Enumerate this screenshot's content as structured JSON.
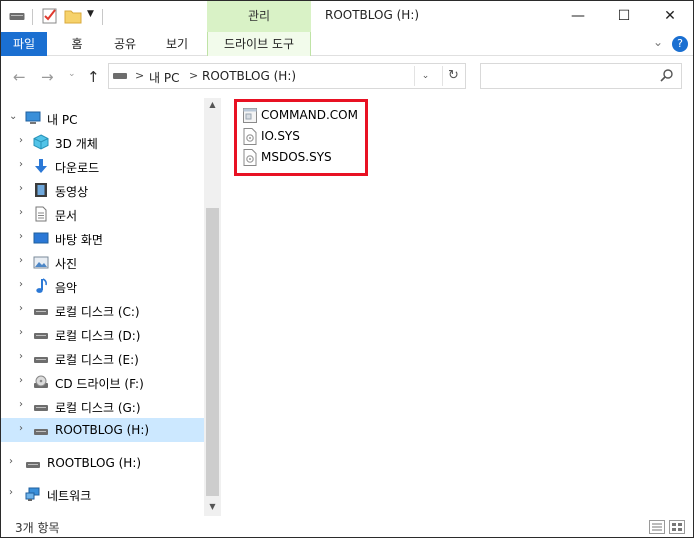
{
  "window": {
    "title": "ROOTBLOG (H:)",
    "context_tab_header": "관리",
    "controls": {
      "minimize": "—",
      "maximize": "☐",
      "close": "✕"
    }
  },
  "ribbon": {
    "tabs": [
      {
        "label": "파일"
      },
      {
        "label": "홈"
      },
      {
        "label": "공유"
      },
      {
        "label": "보기"
      },
      {
        "label": "드라이브 도구"
      }
    ],
    "help": "?"
  },
  "address": {
    "crumbs": [
      "내 PC",
      "ROOTBLOG (H:)"
    ],
    "separator": ">",
    "search_placeholder": ""
  },
  "nav_tree": [
    {
      "label": "내 PC",
      "icon": "pc-icon",
      "expanded": true
    },
    {
      "label": "3D 개체",
      "icon": "3d-objects-icon"
    },
    {
      "label": "다운로드",
      "icon": "download-icon"
    },
    {
      "label": "동영상",
      "icon": "video-icon"
    },
    {
      "label": "문서",
      "icon": "document-icon"
    },
    {
      "label": "바탕 화면",
      "icon": "desktop-icon"
    },
    {
      "label": "사진",
      "icon": "pictures-icon"
    },
    {
      "label": "음악",
      "icon": "music-icon"
    },
    {
      "label": "로컬 디스크 (C:)",
      "icon": "drive-icon"
    },
    {
      "label": "로컬 디스크 (D:)",
      "icon": "drive-icon"
    },
    {
      "label": "로컬 디스크 (E:)",
      "icon": "drive-icon"
    },
    {
      "label": "CD 드라이브 (F:)",
      "icon": "cd-drive-icon"
    },
    {
      "label": "로컬 디스크 (G:)",
      "icon": "drive-icon"
    },
    {
      "label": "ROOTBLOG (H:)",
      "icon": "drive-icon",
      "selected": true
    },
    {
      "label": "ROOTBLOG (H:)",
      "icon": "drive-icon"
    },
    {
      "label": "네트워크",
      "icon": "network-icon"
    }
  ],
  "files": [
    {
      "name": "COMMAND.COM",
      "icon": "com-file-icon"
    },
    {
      "name": "IO.SYS",
      "icon": "sys-file-icon"
    },
    {
      "name": "MSDOS.SYS",
      "icon": "sys-file-icon"
    }
  ],
  "status": {
    "item_count": "3개 항목"
  },
  "colors": {
    "accent": "#1a6fd1",
    "context_tab": "#d9f2c6",
    "selection": "#cce8ff",
    "highlight_box": "#e81123"
  }
}
